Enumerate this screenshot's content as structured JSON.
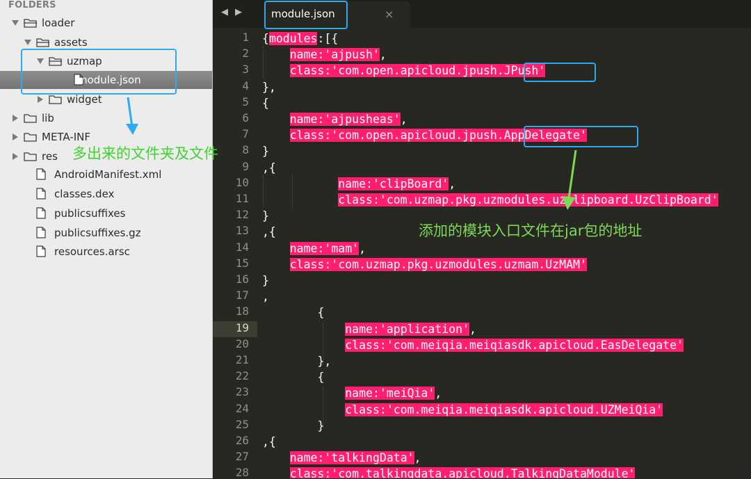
{
  "sidebar": {
    "title": "FOLDERS",
    "items": [
      {
        "label": "loader",
        "type": "folder",
        "open": true
      },
      {
        "label": "assets",
        "type": "folder",
        "open": true
      },
      {
        "label": "uzmap",
        "type": "folder",
        "open": true
      },
      {
        "label": "module.json",
        "type": "file",
        "selected": true
      },
      {
        "label": "widget",
        "type": "folder",
        "open": false
      },
      {
        "label": "lib",
        "type": "folder",
        "open": false
      },
      {
        "label": "META-INF",
        "type": "folder",
        "open": false
      },
      {
        "label": "res",
        "type": "folder",
        "open": false
      },
      {
        "label": "AndroidManifest.xml",
        "type": "file"
      },
      {
        "label": "classes.dex",
        "type": "file"
      },
      {
        "label": "publicsuffixes",
        "type": "file"
      },
      {
        "label": "publicsuffixes.gz",
        "type": "file"
      },
      {
        "label": "resources.arsc",
        "type": "file"
      }
    ]
  },
  "tabbar": {
    "back_glyph": "◀",
    "forward_glyph": "▶",
    "active_tab": "module.json",
    "close_glyph": "×"
  },
  "editor": {
    "line_numbers": [
      "1",
      "2",
      "3",
      "4",
      "5",
      "6",
      "7",
      "8",
      "9",
      "10",
      "11",
      "12",
      "13",
      "14",
      "15",
      "16",
      "17",
      "18",
      "19",
      "20",
      "21",
      "22",
      "23",
      "24",
      "25",
      "26",
      "27",
      "28"
    ],
    "lines": [
      [
        {
          "t": "{"
        },
        {
          "t": "modules",
          "h": true
        },
        {
          "t": ":[{"
        }
      ],
      [
        {
          "t": "    "
        },
        {
          "t": "name:'ajpush'",
          "h": true
        },
        {
          "t": ","
        }
      ],
      [
        {
          "t": "    "
        },
        {
          "t": "class:'com.open.apicloud.jpush.JPush'",
          "h": true
        }
      ],
      [
        {
          "t": "},"
        }
      ],
      [
        {
          "t": "{"
        }
      ],
      [
        {
          "t": "    "
        },
        {
          "t": "name:'ajpusheas'",
          "h": true
        },
        {
          "t": ","
        }
      ],
      [
        {
          "t": "    "
        },
        {
          "t": "class:'com.open.apicloud.jpush.AppDelegate'",
          "h": true
        }
      ],
      [
        {
          "t": "}"
        }
      ],
      [
        {
          "t": ",{"
        }
      ],
      [
        {
          "t": "           "
        },
        {
          "t": "name:'clipBoard'",
          "h": true
        },
        {
          "t": ","
        }
      ],
      [
        {
          "t": "           "
        },
        {
          "t": "class:'com.uzmap.pkg.uzmodules.uzclipboard.UzClipBoard'",
          "h": true
        }
      ],
      [
        {
          "t": "}"
        }
      ],
      [
        {
          "t": ",{"
        }
      ],
      [
        {
          "t": "    "
        },
        {
          "t": "name:'mam'",
          "h": true
        },
        {
          "t": ","
        }
      ],
      [
        {
          "t": "    "
        },
        {
          "t": "class:'com.uzmap.pkg.uzmodules.uzmam.UzMAM'",
          "h": true
        }
      ],
      [
        {
          "t": "}"
        }
      ],
      [
        {
          "t": ","
        }
      ],
      [
        {
          "t": "        {"
        }
      ],
      [
        {
          "t": "            "
        },
        {
          "t": "name:'application'",
          "h": true
        },
        {
          "t": ","
        }
      ],
      [
        {
          "t": "            "
        },
        {
          "t": "class:'com.meiqia.meiqiasdk.apicloud.EasDelegate'",
          "h": true
        }
      ],
      [
        {
          "t": "        },"
        }
      ],
      [
        {
          "t": "        {"
        }
      ],
      [
        {
          "t": "            "
        },
        {
          "t": "name:'meiQia'",
          "h": true
        },
        {
          "t": ","
        }
      ],
      [
        {
          "t": "            "
        },
        {
          "t": "class:'com.meiqia.meiqiasdk.apicloud.UZMeiQia'",
          "h": true
        }
      ],
      [
        {
          "t": "        }"
        }
      ],
      [
        {
          "t": ",{"
        }
      ],
      [
        {
          "t": "    "
        },
        {
          "t": "name:'talkingData'",
          "h": true
        },
        {
          "t": ","
        }
      ],
      [
        {
          "t": "    "
        },
        {
          "t": "class:'com.talkingdata.apicloud.TalkingDataModule'",
          "h": true
        }
      ]
    ]
  },
  "annotations": {
    "folder_note": "多出来的文件夹及文件",
    "entry_note": "添加的模块入口文件在jar包的地址",
    "folder_note_color": "#3fd32f",
    "entry_note_color": "#7ed957",
    "box_color": "#2fa9f2"
  },
  "colors": {
    "editor_bg": "#272822",
    "highlight": "#ff1f6e",
    "sidebar_bg": "#ececec"
  }
}
